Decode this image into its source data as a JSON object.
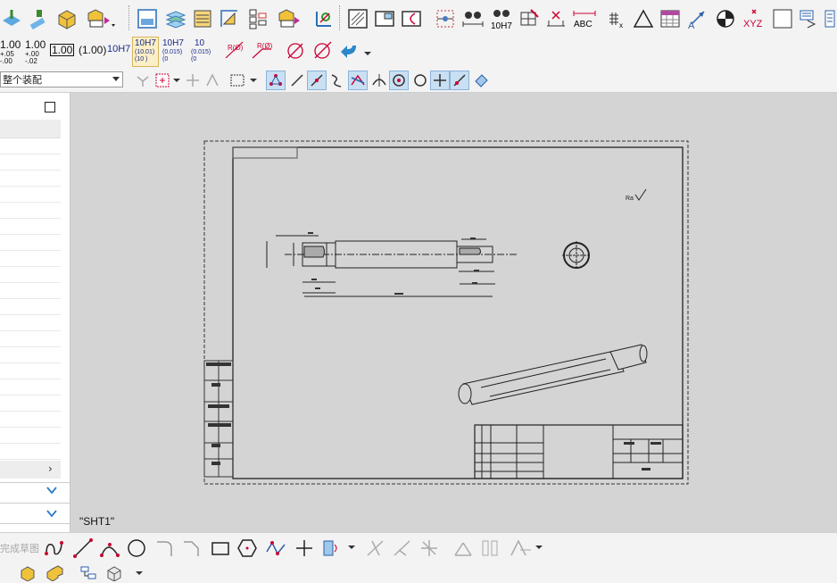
{
  "toolbar_top": {
    "icons": [
      "extrude-icon",
      "hammer-icon",
      "cube-icon",
      "annotate-icon",
      "drawing-view-icon",
      "section-view-icon",
      "detail-view-icon",
      "break-view-icon",
      "table-icon",
      "balloon-icon",
      "axis-icon",
      "frame-icon",
      "rect-frame-icon",
      "partial-view-icon",
      "hole-table-icon",
      "linear-dim-icon",
      "tolerance-icon",
      "weld-icon",
      "datum-icon",
      "dimension-icon",
      "text-icon",
      "matrix-icon",
      "triangle-icon",
      "hatch-icon",
      "leader-icon",
      "center-icon",
      "coordinate-icon",
      "square-icon",
      "list-icon"
    ],
    "label_10h7": "10H7",
    "label_abc": "ABC",
    "label_xyz": "XYZ"
  },
  "tolerance_bar": {
    "t1_main": "1.00",
    "t1_top": "+.05",
    "t1_bot": "-.00",
    "t2_main": "1.00",
    "t2_top": "+.00",
    "t2_bot": "-.02",
    "t3": "1.00",
    "t4": "(1.00)",
    "t5": "10H7",
    "t6_main": "10H7",
    "t6_sub1": "(10.01)",
    "t6_sub2": "(10  )",
    "t7_main": "10H7",
    "t7_sub1": "(0.015)",
    "t7_sub2": "(0",
    "t8_main": "10",
    "t8_sub1": "(0.015)",
    "t8_sub2": "(0",
    "r1": "R(Ø)",
    "r2": "R(Ø)"
  },
  "assembly_select": {
    "value": "整个装配"
  },
  "panel": {
    "rows": 20
  },
  "drawing": {
    "sheet_name": "\"SHT1\"",
    "roughness": "Ra"
  },
  "bottom_bar": {
    "finish_sketch": "完成草图"
  }
}
